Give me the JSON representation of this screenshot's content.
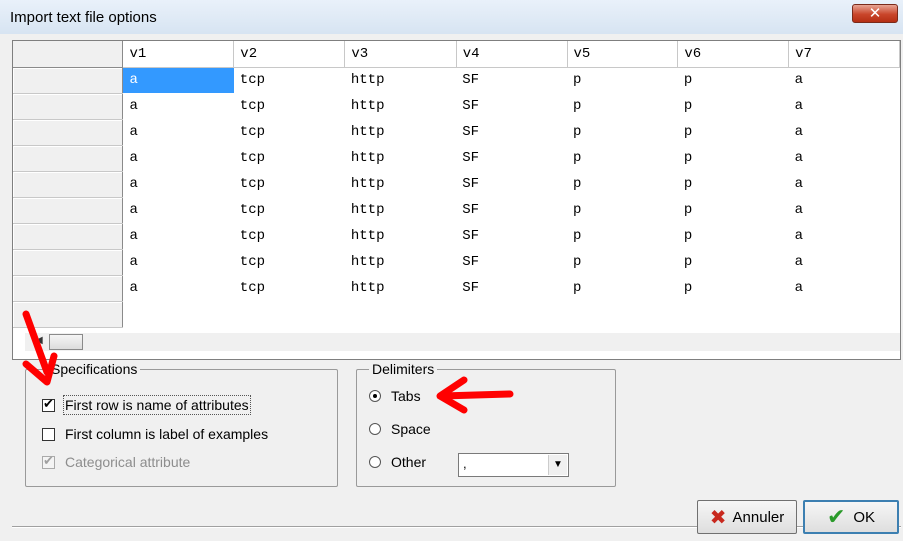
{
  "window": {
    "title": "Import text file options",
    "close_glyph": "✕"
  },
  "grid": {
    "columns": [
      "v1",
      "v2",
      "v3",
      "v4",
      "v5",
      "v6",
      "v7"
    ],
    "rows": [
      [
        "a",
        "tcp",
        "http",
        "SF",
        "p",
        "p",
        "a"
      ],
      [
        "a",
        "tcp",
        "http",
        "SF",
        "p",
        "p",
        "a"
      ],
      [
        "a",
        "tcp",
        "http",
        "SF",
        "p",
        "p",
        "a"
      ],
      [
        "a",
        "tcp",
        "http",
        "SF",
        "p",
        "p",
        "a"
      ],
      [
        "a",
        "tcp",
        "http",
        "SF",
        "p",
        "p",
        "a"
      ],
      [
        "a",
        "tcp",
        "http",
        "SF",
        "p",
        "p",
        "a"
      ],
      [
        "a",
        "tcp",
        "http",
        "SF",
        "p",
        "p",
        "a"
      ],
      [
        "a",
        "tcp",
        "http",
        "SF",
        "p",
        "p",
        "a"
      ],
      [
        "a",
        "tcp",
        "http",
        "SF",
        "p",
        "p",
        "a"
      ]
    ],
    "selected_cell": "row 1, v1"
  },
  "specifications": {
    "legend": "Specifications",
    "first_row_names": {
      "label": "First row is name of attributes",
      "checked": true
    },
    "first_col_labels": {
      "label": "First column is label of examples",
      "checked": false
    },
    "categorical": {
      "label": "Categorical attribute",
      "checked": true,
      "disabled": true
    }
  },
  "delimiters": {
    "legend": "Delimiters",
    "tabs": {
      "label": "Tabs",
      "selected": true
    },
    "space": {
      "label": "Space",
      "selected": false
    },
    "other": {
      "label": "Other",
      "selected": false,
      "value": ","
    }
  },
  "buttons": {
    "cancel": "Annuler",
    "ok": "OK"
  },
  "annotations": {
    "arrow_color": "#ff0000"
  }
}
